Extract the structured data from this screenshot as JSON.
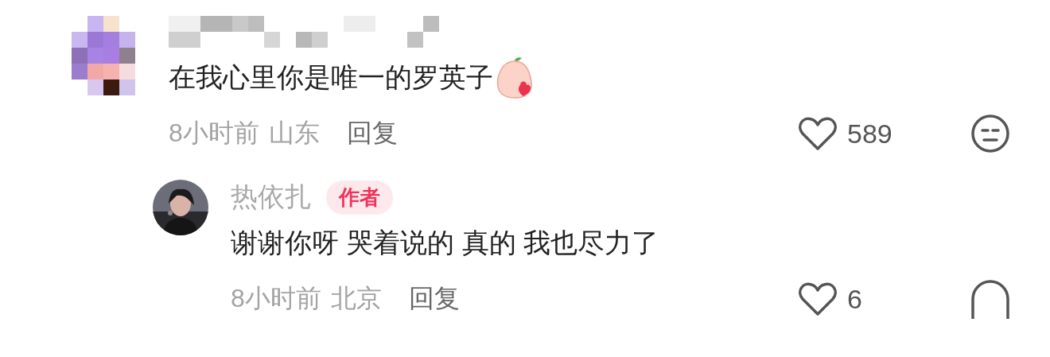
{
  "comments": [
    {
      "author": {
        "kind": "mosaic"
      },
      "avatar": {
        "kind": "mosaic"
      },
      "text": "在我心里你是唯一的罗英子",
      "sticker": true,
      "time": "8小时前",
      "location": "山东",
      "reply": "回复",
      "likes": "589",
      "dislike_cropped": false,
      "children": [
        {
          "author": {
            "kind": "name",
            "name": "热依扎",
            "badge": "作者"
          },
          "text": "谢谢你呀 哭着说的 真的 我也尽力了",
          "sticker": false,
          "time": "8小时前",
          "location": "北京",
          "reply": "回复",
          "likes": "6",
          "dislike_cropped": true
        }
      ]
    }
  ]
}
